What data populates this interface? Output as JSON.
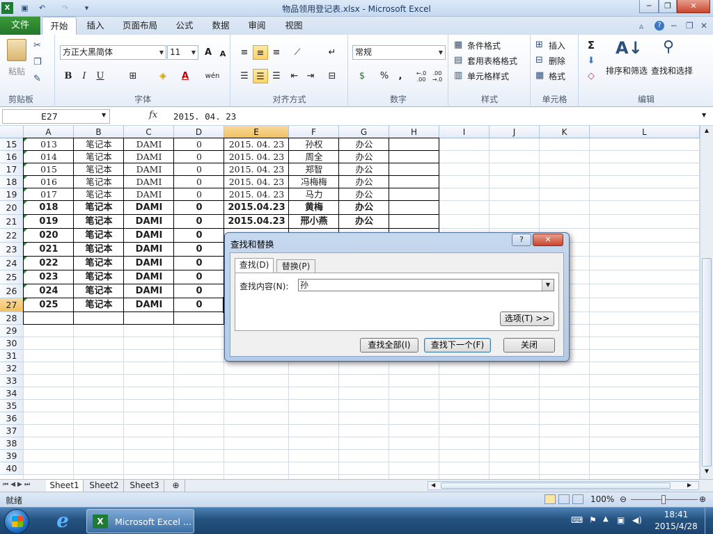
{
  "window": {
    "title": "物品领用登记表.xlsx - Microsoft Excel",
    "minimize_glyph": "─",
    "restore_glyph": "❐",
    "close_glyph": "✕"
  },
  "ribbon_tabs": [
    "文件",
    "开始",
    "插入",
    "页面布局",
    "公式",
    "数据",
    "审阅",
    "视图"
  ],
  "ribbon": {
    "clipboard": {
      "label": "剪贴板",
      "paste": "粘贴"
    },
    "font": {
      "label": "字体",
      "name": "方正大黑简体",
      "size": "11",
      "bold": "B",
      "italic": "I",
      "underline": "U",
      "grow": "A",
      "shrink": "A",
      "font_color": "A",
      "phonetic": "wén"
    },
    "alignment": {
      "label": "对齐方式"
    },
    "number": {
      "label": "数字",
      "format": "常规",
      "percent": "%",
      "comma": ",",
      "inc_dec": "←.0 .00",
      "dec_dec": ".00 →.0"
    },
    "styles": {
      "label": "样式",
      "cond": "条件格式",
      "table": "套用表格格式",
      "cell": "单元格样式"
    },
    "cells": {
      "label": "单元格",
      "insert": "插入",
      "delete": "删除",
      "format": "格式"
    },
    "editing": {
      "label": "编辑",
      "sum": "Σ",
      "sort": "排序和筛选",
      "find": "查找和选择"
    }
  },
  "formula_bar": {
    "name_box": "E27",
    "fx": "fx",
    "content": "2015. 04. 23"
  },
  "columns": [
    "A",
    "B",
    "C",
    "D",
    "E",
    "F",
    "G",
    "H",
    "I",
    "J",
    "K",
    "L"
  ],
  "selected_column": "E",
  "rows": [
    {
      "n": "15",
      "cells": [
        "013",
        "笔记本",
        "DAMI",
        "0",
        "2015. 04. 23",
        "孙权",
        "办公"
      ],
      "bold": false
    },
    {
      "n": "16",
      "cells": [
        "014",
        "笔记本",
        "DAMI",
        "0",
        "2015. 04. 23",
        "周全",
        "办公"
      ],
      "bold": false
    },
    {
      "n": "17",
      "cells": [
        "015",
        "笔记本",
        "DAMI",
        "0",
        "2015. 04. 23",
        "郑智",
        "办公"
      ],
      "bold": false
    },
    {
      "n": "18",
      "cells": [
        "016",
        "笔记本",
        "DAMI",
        "0",
        "2015. 04. 23",
        "冯梅梅",
        "办公"
      ],
      "bold": false
    },
    {
      "n": "19",
      "cells": [
        "017",
        "笔记本",
        "DAMI",
        "0",
        "2015. 04. 23",
        "马力",
        "办公"
      ],
      "bold": false
    },
    {
      "n": "20",
      "cells": [
        "018",
        "笔记本",
        "DAMI",
        "0",
        "2015.04.23",
        "黄梅",
        "办公"
      ],
      "bold": true
    },
    {
      "n": "21",
      "cells": [
        "019",
        "笔记本",
        "DAMI",
        "0",
        "2015.04.23",
        "邢小燕",
        "办公"
      ],
      "bold": true
    },
    {
      "n": "22",
      "cells": [
        "020",
        "笔记本",
        "DAMI",
        "0",
        "",
        "",
        ""
      ],
      "bold": true
    },
    {
      "n": "23",
      "cells": [
        "021",
        "笔记本",
        "DAMI",
        "0",
        "",
        "",
        ""
      ],
      "bold": true
    },
    {
      "n": "24",
      "cells": [
        "022",
        "笔记本",
        "DAMI",
        "0",
        "",
        "",
        ""
      ],
      "bold": true
    },
    {
      "n": "25",
      "cells": [
        "023",
        "笔记本",
        "DAMI",
        "0",
        "",
        "",
        ""
      ],
      "bold": true
    },
    {
      "n": "26",
      "cells": [
        "024",
        "笔记本",
        "DAMI",
        "0",
        "",
        "",
        ""
      ],
      "bold": true
    },
    {
      "n": "27",
      "cells": [
        "025",
        "笔记本",
        "DAMI",
        "0",
        "",
        "",
        ""
      ],
      "bold": true
    },
    {
      "n": "28",
      "cells": [
        "",
        "",
        "",
        "",
        "",
        "",
        ""
      ],
      "bold": false
    },
    {
      "n": "29"
    },
    {
      "n": "30"
    },
    {
      "n": "31"
    },
    {
      "n": "32"
    },
    {
      "n": "33"
    },
    {
      "n": "34"
    },
    {
      "n": "35"
    },
    {
      "n": "36"
    },
    {
      "n": "37"
    },
    {
      "n": "38"
    },
    {
      "n": "39"
    },
    {
      "n": "40"
    }
  ],
  "selected_row": "27",
  "sheet_tabs": [
    "Sheet1",
    "Sheet2",
    "Sheet3"
  ],
  "active_sheet": "Sheet1",
  "status": {
    "ready": "就绪",
    "zoom": "100%"
  },
  "dialog": {
    "title": "查找和替换",
    "help": "?",
    "close": "✕",
    "tab_find": "查找(D)",
    "tab_replace": "替换(P)",
    "find_label": "查找内容(N):",
    "find_value": "孙",
    "options_button": "选项(T) >>",
    "find_all_button": "查找全部(I)",
    "find_next_button": "查找下一个(F)",
    "close_button": "关闭"
  },
  "taskbar": {
    "app_label": "Microsoft Excel ...",
    "time": "18:41",
    "date": "2015/4/28"
  },
  "colors": {
    "accent_green": "#23772a",
    "selection_orange": "#f1c15f",
    "taskbar_blue": "#24527f"
  }
}
